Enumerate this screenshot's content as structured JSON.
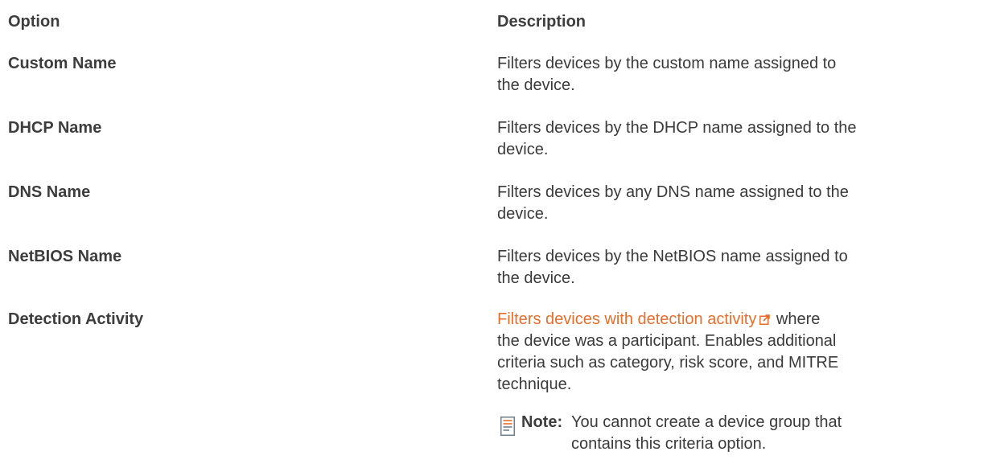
{
  "table": {
    "headers": {
      "option": "Option",
      "description": "Description"
    },
    "rows": [
      {
        "option": "Custom Name",
        "description_line1": "Filters devices by the custom name assigned to",
        "description_line2": "the device."
      },
      {
        "option": "DHCP Name",
        "description_line1": "Filters devices by the DHCP name assigned to the",
        "description_line2": "device."
      },
      {
        "option": "DNS Name",
        "description_line1": "Filters devices by any DNS name assigned to the",
        "description_line2": "device."
      },
      {
        "option": "NetBIOS Name",
        "description_line1": "Filters devices by the NetBIOS name assigned to",
        "description_line2": "the device."
      },
      {
        "option": "Detection Activity",
        "link_text": "Filters devices with detection activity",
        "description_rest1": "where",
        "description_line2": "the device was a participant. Enables additional",
        "description_line3": "criteria such as category, risk score, and MITRE",
        "description_line4": "technique."
      }
    ],
    "note": {
      "label": "Note:",
      "text_line1": "You cannot create a device group that",
      "text_line2": "contains this criteria option."
    }
  },
  "colors": {
    "link": "#e86e2c",
    "text": "#3a3a3a"
  },
  "icons": {
    "external_link": "external-link-icon",
    "note": "note-icon"
  }
}
